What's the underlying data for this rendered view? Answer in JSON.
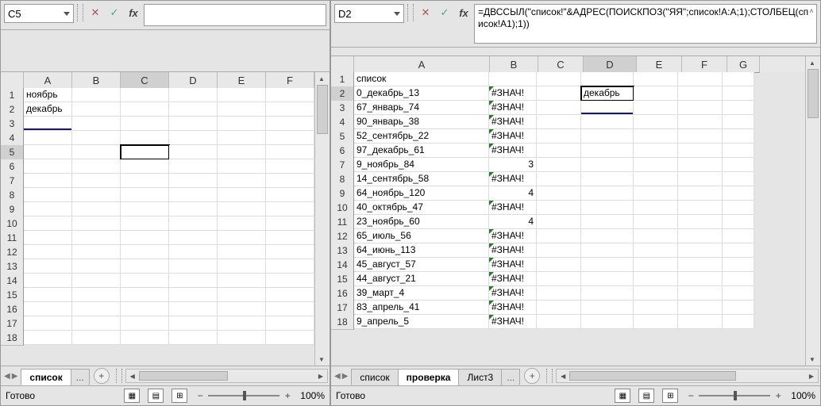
{
  "left": {
    "namebox": "C5",
    "formula": "",
    "cols": [
      "A",
      "B",
      "C",
      "D",
      "E",
      "F"
    ],
    "rows": [
      1,
      2,
      3,
      4,
      5,
      6,
      7,
      8,
      9,
      10,
      11,
      12,
      13,
      14,
      15,
      16,
      17,
      18
    ],
    "data": {
      "r1": {
        "A": "ноябрь"
      },
      "r2": {
        "A": "декабрь"
      }
    },
    "tabs": {
      "active": "список",
      "more": "...",
      "add": "+"
    },
    "status": "Готово",
    "zoom": "100%"
  },
  "right": {
    "namebox": "D2",
    "formula": "=ДВССЫЛ(\"список!\"&АДРЕС(ПОИСКПОЗ(\"ЯЯ\";список!A:A;1);СТОЛБЕЦ(список!A1);1))",
    "cols": [
      "A",
      "B",
      "C",
      "D",
      "E",
      "F",
      "G"
    ],
    "colw": {
      "A": 170,
      "B": 60,
      "C": 56,
      "D": 66,
      "E": 56,
      "F": 56,
      "G": 40
    },
    "rows": [
      1,
      2,
      3,
      4,
      5,
      6,
      7,
      8,
      9,
      10,
      11,
      12,
      13,
      14,
      15,
      16,
      17,
      18
    ],
    "data": {
      "r1": {
        "A": "список"
      },
      "r2": {
        "A": "0_декабрь_13",
        "B": "#ЗНАЧ!",
        "D": "декабрь"
      },
      "r3": {
        "A": "67_январь_74",
        "B": "#ЗНАЧ!"
      },
      "r4": {
        "A": "90_январь_38",
        "B": "#ЗНАЧ!"
      },
      "r5": {
        "A": "52_сентябрь_22",
        "B": "#ЗНАЧ!"
      },
      "r6": {
        "A": "97_декабрь_61",
        "B": "#ЗНАЧ!"
      },
      "r7": {
        "A": "9_ноябрь_84",
        "B": "3"
      },
      "r8": {
        "A": "14_сентябрь_58",
        "B": "#ЗНАЧ!"
      },
      "r9": {
        "A": "64_ноябрь_120",
        "B": "4"
      },
      "r10": {
        "A": "40_октябрь_47",
        "B": "#ЗНАЧ!"
      },
      "r11": {
        "A": "23_ноябрь_60",
        "B": "4"
      },
      "r12": {
        "A": "65_июль_56",
        "B": "#ЗНАЧ!"
      },
      "r13": {
        "A": "64_июнь_113",
        "B": "#ЗНАЧ!"
      },
      "r14": {
        "A": "45_август_57",
        "B": "#ЗНАЧ!"
      },
      "r15": {
        "A": "44_август_21",
        "B": "#ЗНАЧ!"
      },
      "r16": {
        "A": "39_март_4",
        "B": "#ЗНАЧ!"
      },
      "r17": {
        "A": "83_апрель_41",
        "B": "#ЗНАЧ!"
      },
      "r18": {
        "A": "9_апрель_5",
        "B": "#ЗНАЧ!"
      }
    },
    "tabs": {
      "items": [
        "список",
        "проверка",
        "Лист3"
      ],
      "active": "проверка",
      "more": "...",
      "add": "+"
    },
    "status": "Готово",
    "zoom": "100%"
  },
  "icons": {
    "cancel": "✕",
    "accept": "✓",
    "fx": "fx",
    "left": "◀",
    "right": "▶",
    "up": "▲",
    "down": "▼",
    "expand": "˄"
  }
}
